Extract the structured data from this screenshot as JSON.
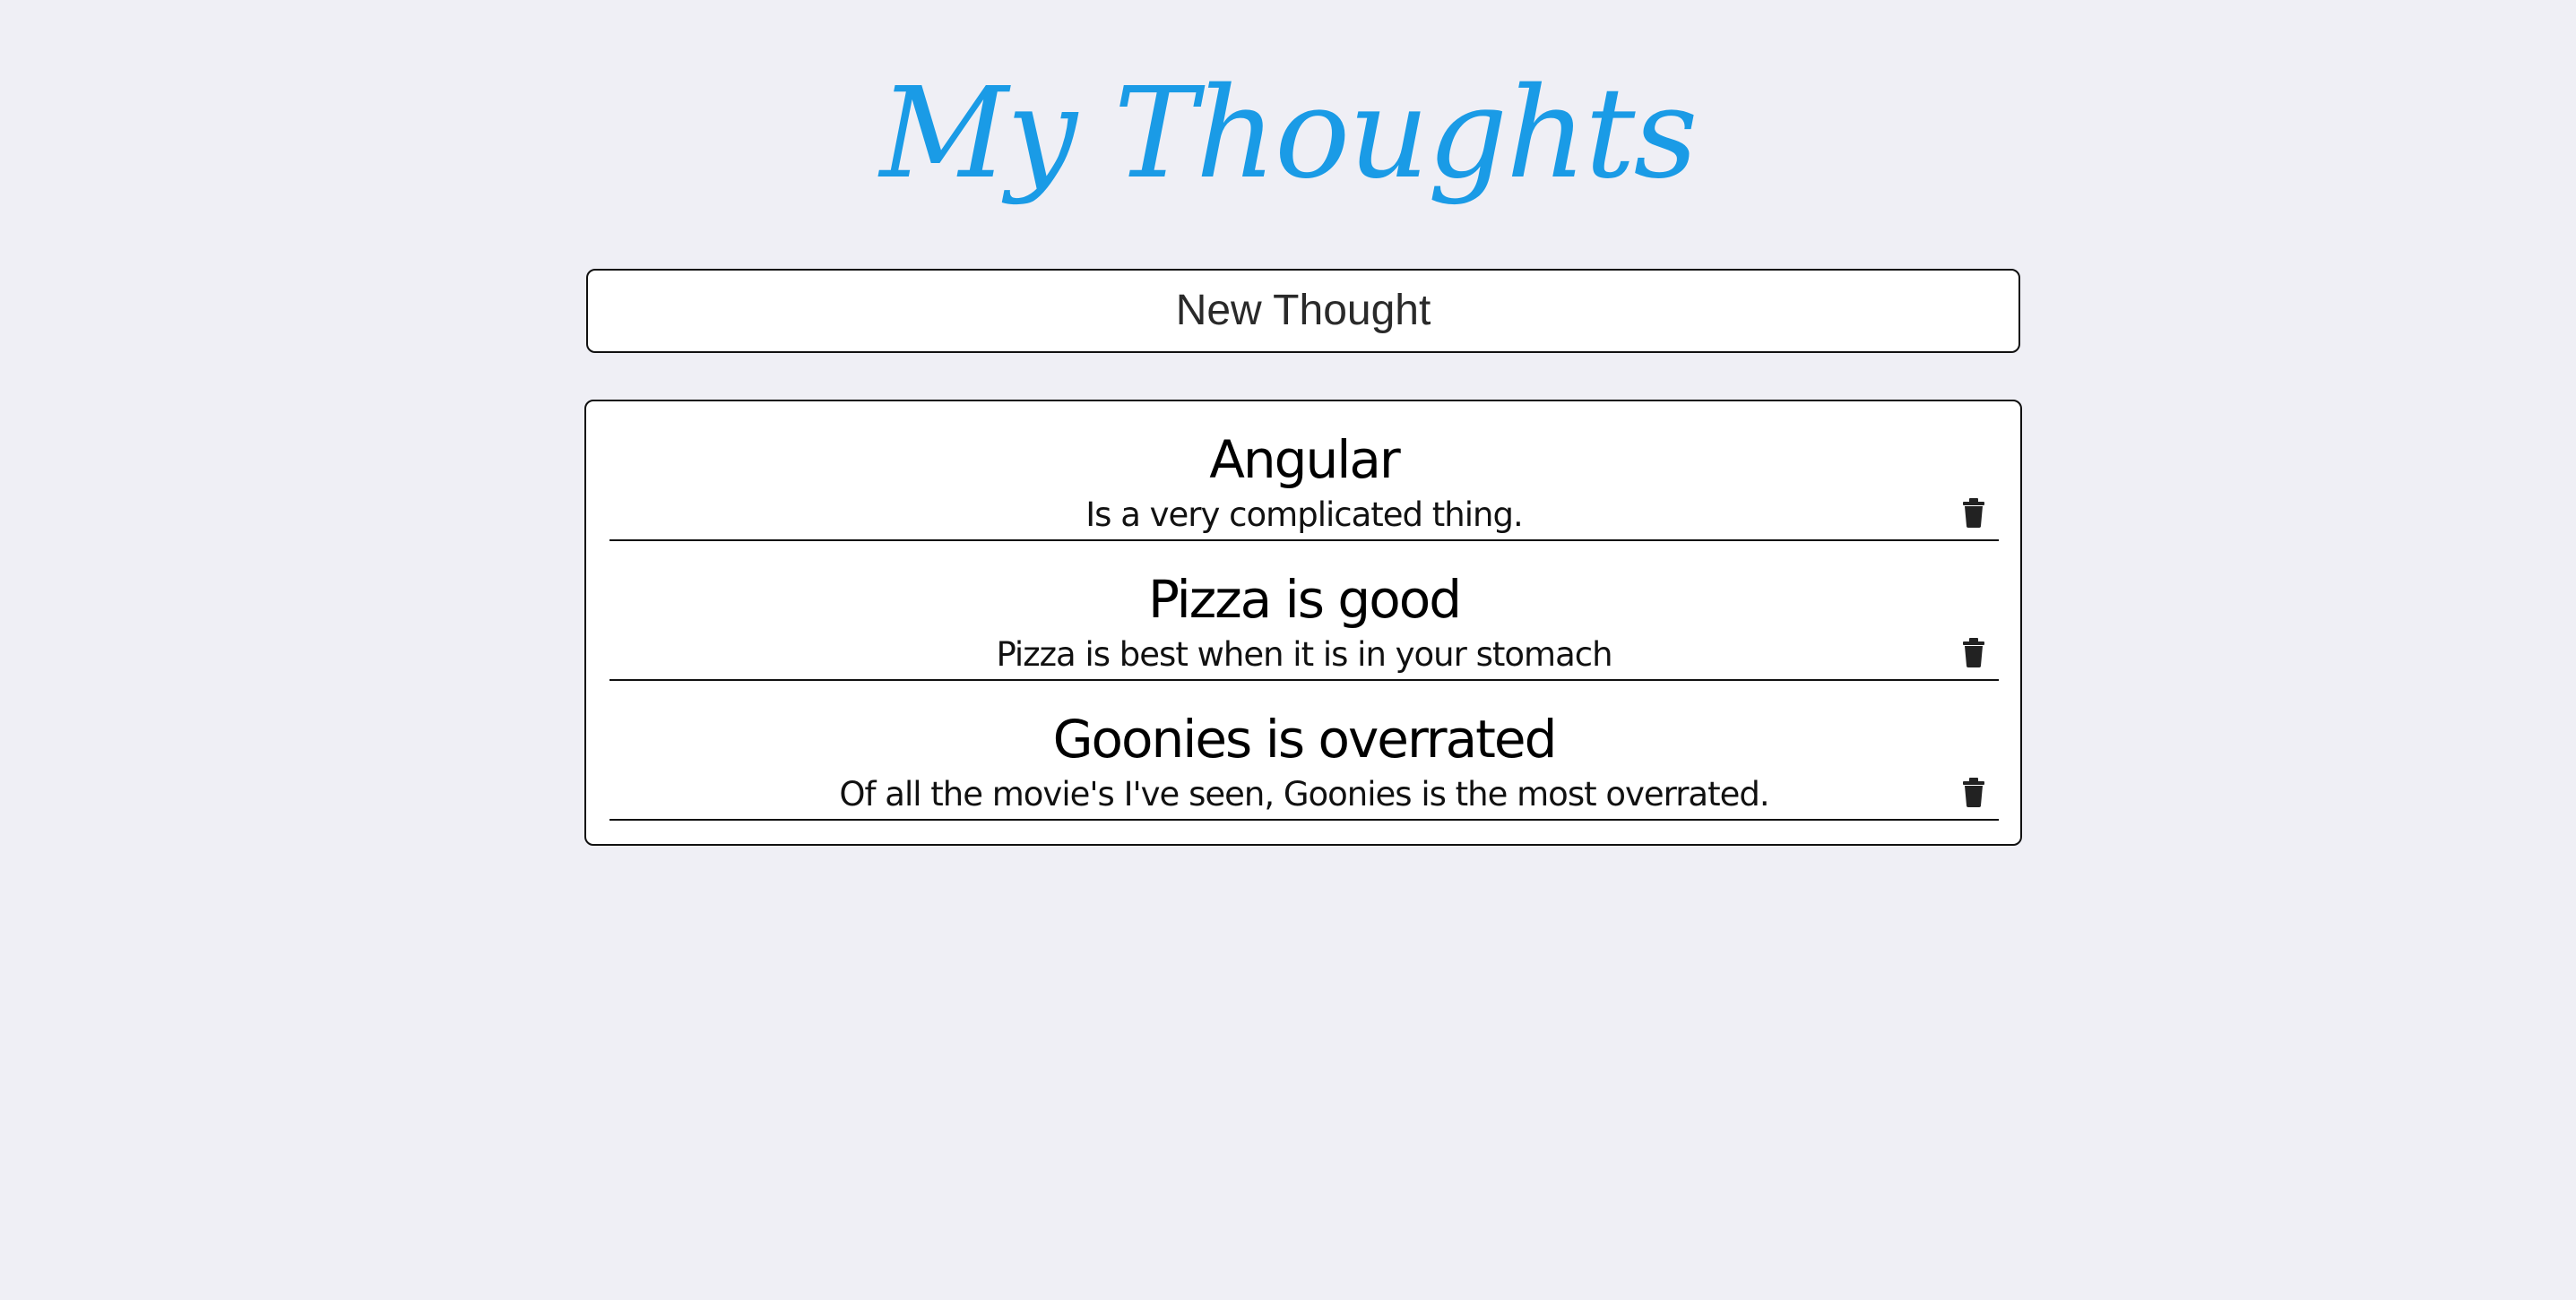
{
  "app": {
    "title": "My Thoughts"
  },
  "new_thought": {
    "label": "New Thought"
  },
  "thoughts": [
    {
      "title": "Angular",
      "body": "Is a very complicated thing.",
      "delete_icon": "trash-icon"
    },
    {
      "title": "Pizza is good",
      "body": "Pizza is best when it is in your stomach",
      "delete_icon": "trash-icon"
    },
    {
      "title": "Goonies is overrated",
      "body": "Of all the movie's I've seen, Goonies is the most overrated.",
      "delete_icon": "trash-icon"
    }
  ],
  "colors": {
    "accent": "#1a9be6",
    "background": "#efeff5",
    "panel": "#ffffff",
    "border": "#111111"
  }
}
